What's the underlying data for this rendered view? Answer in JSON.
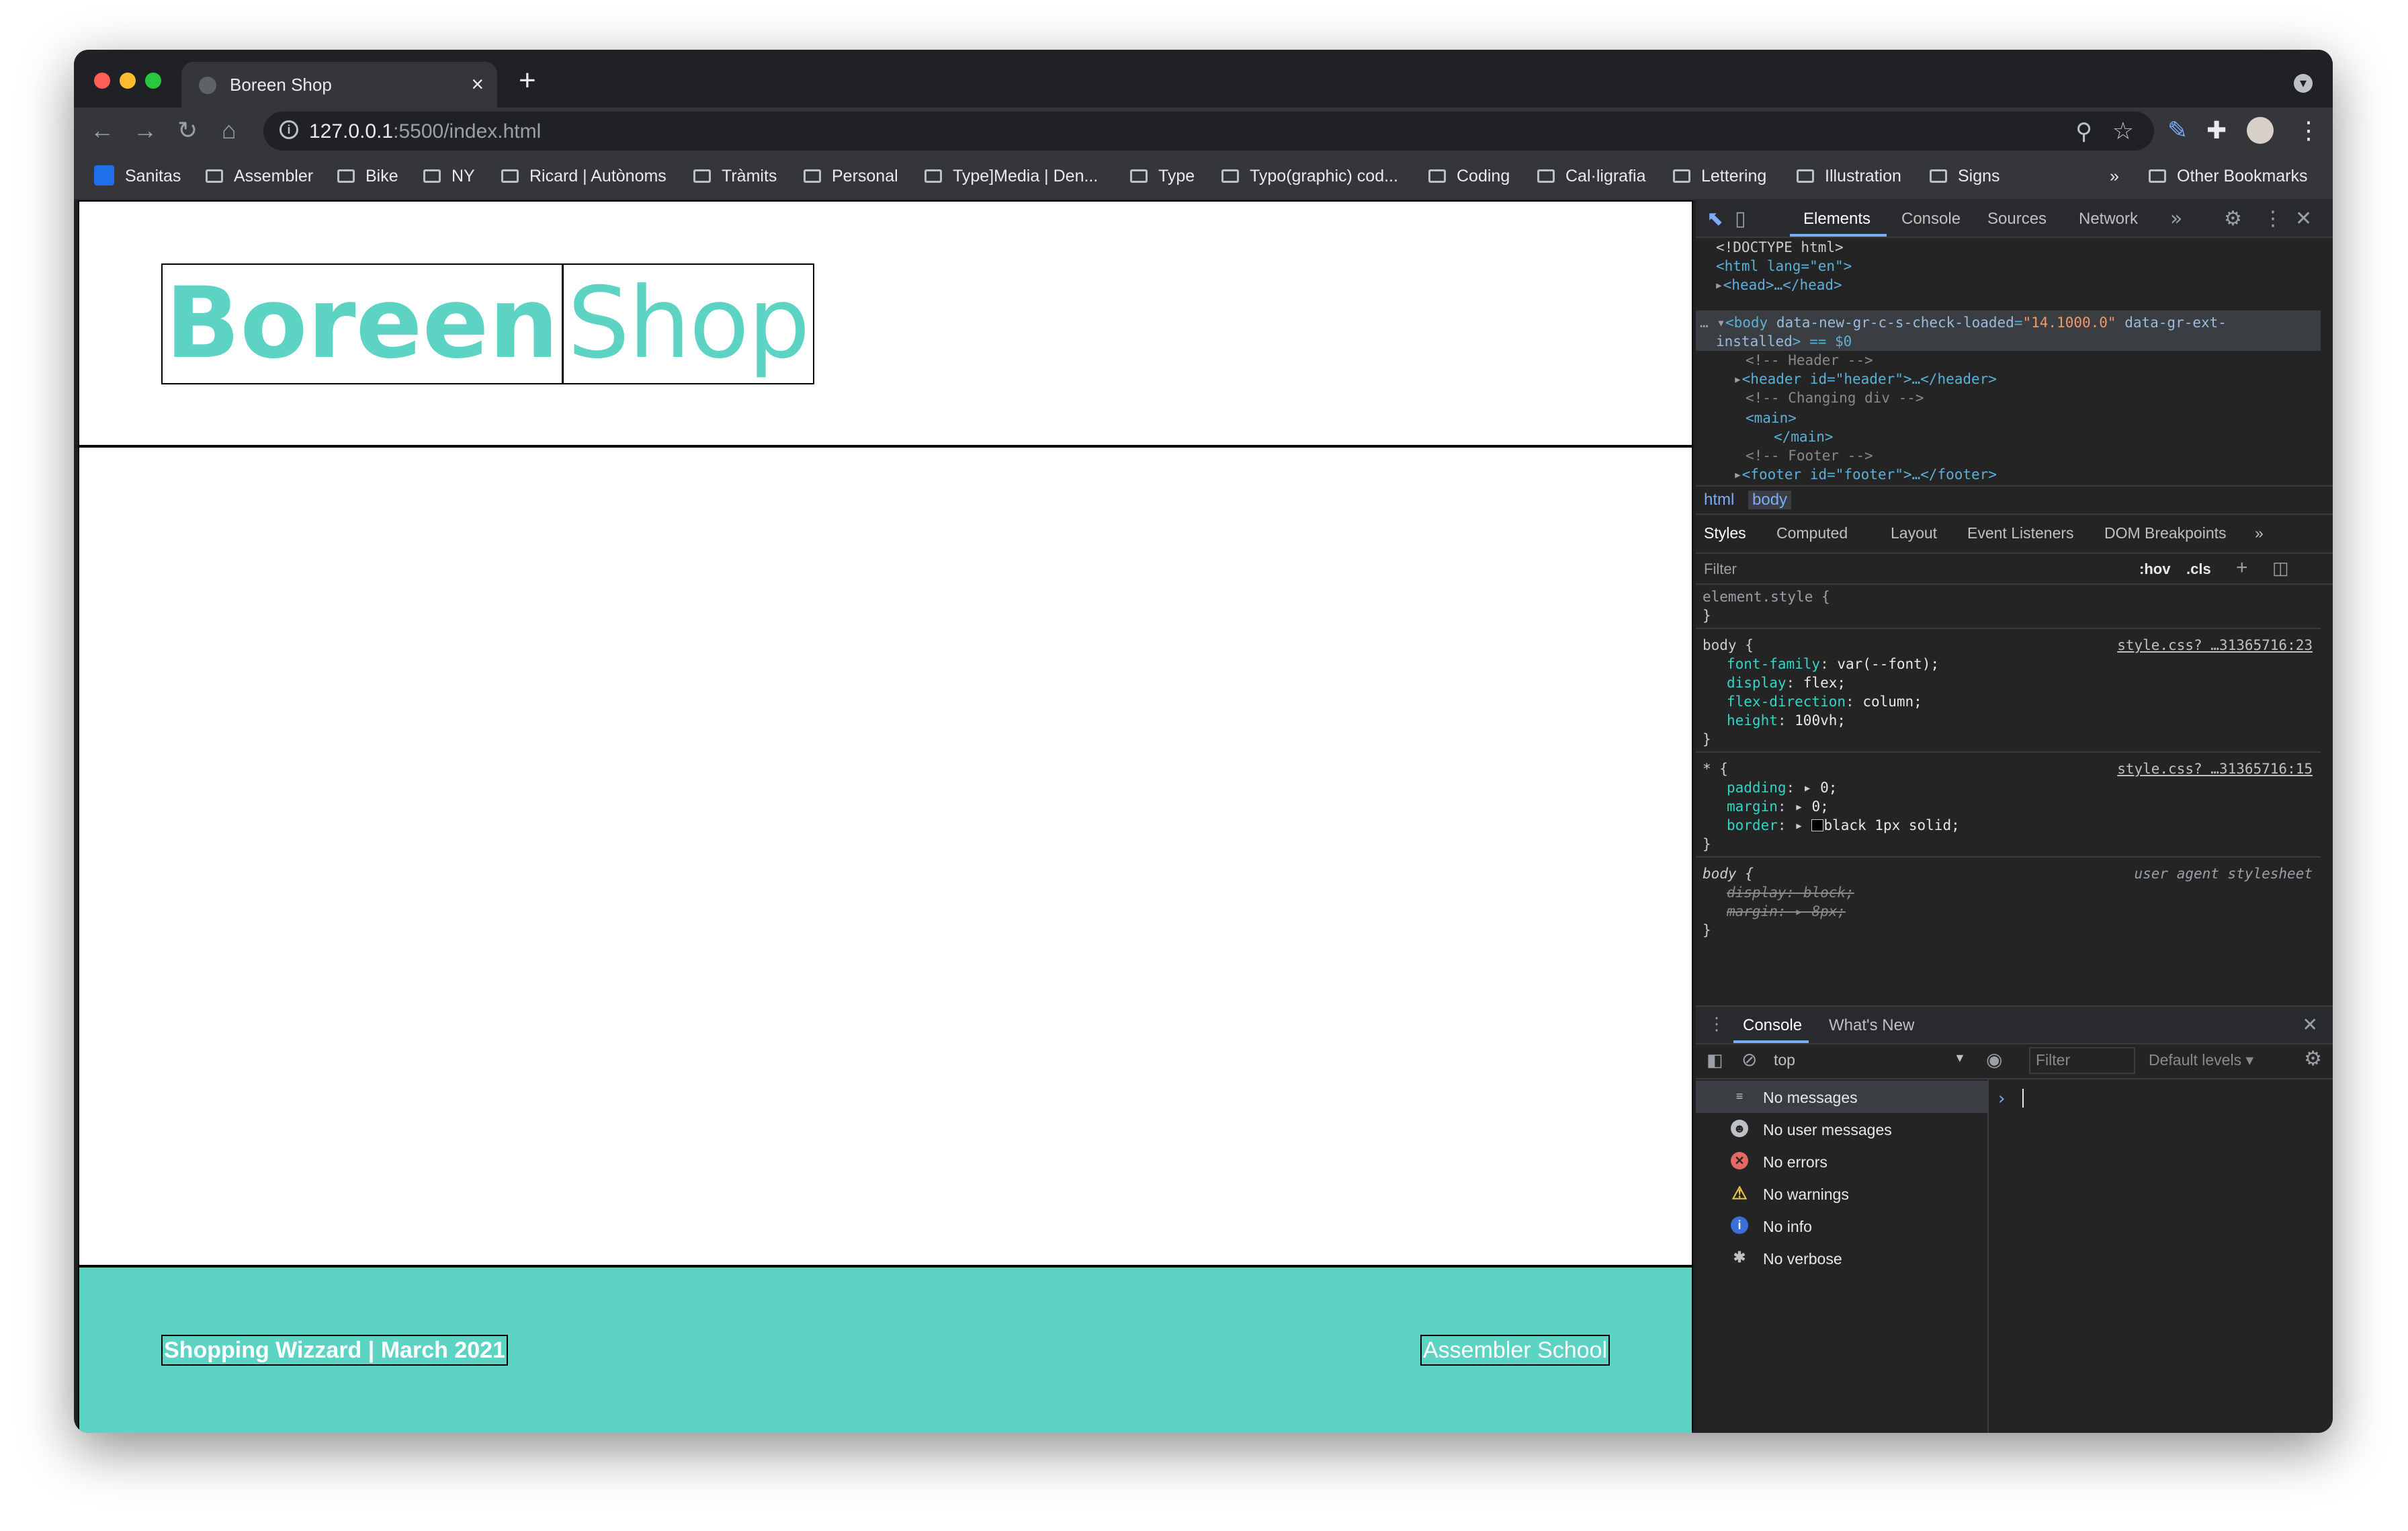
{
  "browser": {
    "tab_title": "Boreen Shop",
    "tab_close": "×",
    "new_tab": "+",
    "url_host": "127.0.0.1",
    "url_rest": ":5500/index.html"
  },
  "bookmarks": [
    {
      "label": "Sanitas",
      "kind": "site"
    },
    {
      "label": "Assembler",
      "kind": "folder"
    },
    {
      "label": "Bike",
      "kind": "folder"
    },
    {
      "label": "NY",
      "kind": "folder"
    },
    {
      "label": "Ricard | Autònoms",
      "kind": "folder"
    },
    {
      "label": "Tràmits",
      "kind": "folder"
    },
    {
      "label": "Personal",
      "kind": "folder"
    },
    {
      "label": "Type]Media | Den...",
      "kind": "folder"
    },
    {
      "label": "Type",
      "kind": "folder"
    },
    {
      "label": "Typo(graphic) cod...",
      "kind": "folder"
    },
    {
      "label": "Coding",
      "kind": "folder"
    },
    {
      "label": "Cal·ligrafia",
      "kind": "folder"
    },
    {
      "label": "Lettering",
      "kind": "folder"
    },
    {
      "label": "Illustration",
      "kind": "folder"
    },
    {
      "label": "Signs",
      "kind": "folder"
    }
  ],
  "bookmarks_overflow": "»",
  "other_bookmarks": "Other Bookmarks",
  "page": {
    "logo_bold": "Boreen",
    "logo_light": "Shop",
    "footer_left": "Shopping Wizzard | March 2021",
    "footer_right": "Assembler School",
    "accent_color": "#5dd3c3"
  },
  "devtools": {
    "tabs": [
      "Elements",
      "Console",
      "Sources",
      "Network"
    ],
    "active_tab": "Elements",
    "dom": {
      "doctype": "<!DOCTYPE html>",
      "html_open": "<html lang=\"en\">",
      "head": "<head>…</head>",
      "body_tag": "<body",
      "body_attr1": "data-new-gr-c-s-check-loaded",
      "body_val1": "\"14.1000.0\"",
      "body_attr2": "data-gr-ext-",
      "body_attr2b": "installed",
      "body_tail": "> == $0",
      "comment_header": "<!-- Header -->",
      "header_line": "<header id=\"header\">…</header>",
      "comment_div": "<!-- Changing div -->",
      "main_open": "<main>",
      "main_close": "</main>",
      "comment_footer": "<!-- Footer -->",
      "footer_line": "<footer id=\"footer\">…</footer>"
    },
    "breadcrumbs": [
      "html",
      "body"
    ],
    "style_tabs": [
      "Styles",
      "Computed",
      "Layout",
      "Event Listeners",
      "DOM Breakpoints"
    ],
    "filter_placeholder": "Filter",
    "hov": ":hov",
    "cls": ".cls",
    "styles": {
      "element_style": "element.style {",
      "close": "}",
      "body_selector": "body {",
      "body_source": "style.css? …31365716:23",
      "body_props": [
        {
          "prop": "font-family",
          "value": "var(--font);"
        },
        {
          "prop": "display",
          "value": "flex;"
        },
        {
          "prop": "flex-direction",
          "value": "column;"
        },
        {
          "prop": "height",
          "value": "100vh;"
        }
      ],
      "star_selector": "* {",
      "star_source": "style.css? …31365716:15",
      "star_props": [
        {
          "prop": "padding",
          "value": "0;"
        },
        {
          "prop": "margin",
          "value": "0;"
        },
        {
          "prop": "border",
          "value": "black 1px solid;"
        }
      ],
      "ua_selector": "body {",
      "ua_source": "user agent stylesheet",
      "ua_props": [
        {
          "prop": "display",
          "value": "block;"
        },
        {
          "prop": "margin",
          "value": "8px;"
        }
      ]
    },
    "drawer_tabs": [
      "Console",
      "What's New"
    ],
    "console_context": "top",
    "console_filter": "Filter",
    "console_levels": "Default levels ▾",
    "console_sidebar": [
      {
        "label": "No messages",
        "icon": "list-icon"
      },
      {
        "label": "No user messages",
        "icon": "user-icon"
      },
      {
        "label": "No errors",
        "icon": "error-icon"
      },
      {
        "label": "No warnings",
        "icon": "warning-icon"
      },
      {
        "label": "No info",
        "icon": "info-icon"
      },
      {
        "label": "No verbose",
        "icon": "bug-icon"
      }
    ],
    "prompt": "›"
  }
}
